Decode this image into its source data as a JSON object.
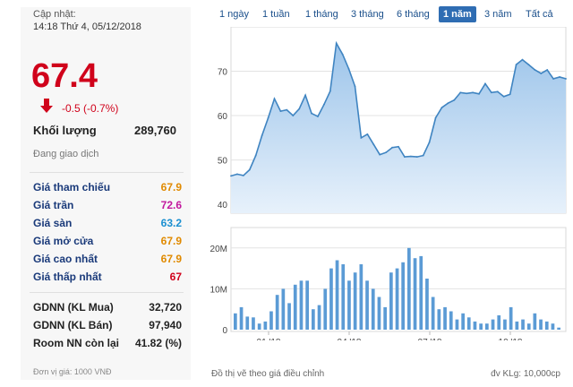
{
  "panel": {
    "updated_label": "Cập nhật:",
    "updated_time": "14:18 Thứ 4, 05/12/2018",
    "price": "67.4",
    "change": "-0.5 (-0.7%)",
    "volume_label": "Khối lượng",
    "volume_value": "289,760",
    "status": "Đang giao dịch",
    "rows": [
      {
        "label": "Giá tham chiếu",
        "value": "67.9",
        "color": "#e08a00"
      },
      {
        "label": "Giá trần",
        "value": "72.6",
        "color": "#c2189e"
      },
      {
        "label": "Giá sàn",
        "value": "63.2",
        "color": "#1a8fd0"
      },
      {
        "label": "Giá mở cửa",
        "value": "67.9",
        "color": "#e08a00"
      },
      {
        "label": "Giá cao nhất",
        "value": "67.9",
        "color": "#e08a00"
      },
      {
        "label": "Giá thấp nhất",
        "value": "67",
        "color": "#d0021b"
      }
    ],
    "rows2": [
      {
        "label": "GDNN (KL Mua)",
        "value": "32,720"
      },
      {
        "label": "GDNN (KL Bán)",
        "value": "97,940"
      },
      {
        "label": "Room NN còn lại",
        "value": "41.82 (%)"
      }
    ],
    "unit_note": "Đơn vị giá: 1000 VNĐ",
    "down_color": "#d0021b"
  },
  "tabs": [
    {
      "label": "1 ngày",
      "active": false
    },
    {
      "label": "1 tuần",
      "active": false
    },
    {
      "label": "1 tháng",
      "active": false
    },
    {
      "label": "3 tháng",
      "active": false
    },
    {
      "label": "6 tháng",
      "active": false
    },
    {
      "label": "1 năm",
      "active": true
    },
    {
      "label": "3 năm",
      "active": false
    },
    {
      "label": "Tất cả",
      "active": false
    }
  ],
  "footer": {
    "left": "Đồ thị vẽ theo giá điều chỉnh",
    "right": "đv KLg: 10,000cp"
  },
  "chart_data": [
    {
      "type": "area",
      "y_ticks": [
        "40",
        "50",
        "60",
        "70"
      ],
      "ylim": [
        38,
        80
      ],
      "grid": true,
      "colors": {
        "line": "#3f84c1",
        "fill_top": "#9cc4ea",
        "fill_bottom": "#e7f1fb"
      },
      "values": [
        46.4,
        46.8,
        46.5,
        47.8,
        51,
        55.5,
        59.5,
        63.8,
        61,
        61.3,
        60,
        61.5,
        64.6,
        60.5,
        59.8,
        62.5,
        65.5,
        76.3,
        73.8,
        70.5,
        66.6,
        55,
        55.8,
        53.5,
        51.2,
        51.7,
        52.8,
        53,
        50.7,
        50.8,
        50.7,
        51,
        54,
        59.5,
        61.8,
        62.8,
        63.5,
        65.2,
        65,
        65.2,
        64.9,
        67.2,
        65.2,
        65.4,
        64.3,
        64.8,
        71.5,
        72.6,
        71.5,
        70.3,
        69.5,
        70.3,
        68.3,
        68.7,
        68.3
      ]
    },
    {
      "type": "bar",
      "x_ticks": [
        "01 '18",
        "04 '18",
        "07 '18",
        "10 '18"
      ],
      "y_ticks": [
        "0",
        "10M",
        "20M"
      ],
      "ylim": [
        0,
        25
      ],
      "grid": true,
      "colors": {
        "bar": "#5b9bd5"
      },
      "values": [
        4,
        5.5,
        3.2,
        3,
        1.5,
        2,
        4.5,
        8.5,
        10,
        6.5,
        11,
        12,
        12,
        5,
        6,
        10,
        15,
        17,
        16,
        12,
        14,
        16,
        12,
        10,
        8,
        5.5,
        14,
        15,
        16.5,
        20,
        17.5,
        18,
        12.5,
        8,
        5,
        5.5,
        4.5,
        2.5,
        4,
        3,
        2,
        1.5,
        1.5,
        2.5,
        3.5,
        2.5,
        5.5,
        2,
        2.5,
        1.5,
        4,
        2.5,
        2,
        1.5,
        0.5
      ]
    }
  ]
}
